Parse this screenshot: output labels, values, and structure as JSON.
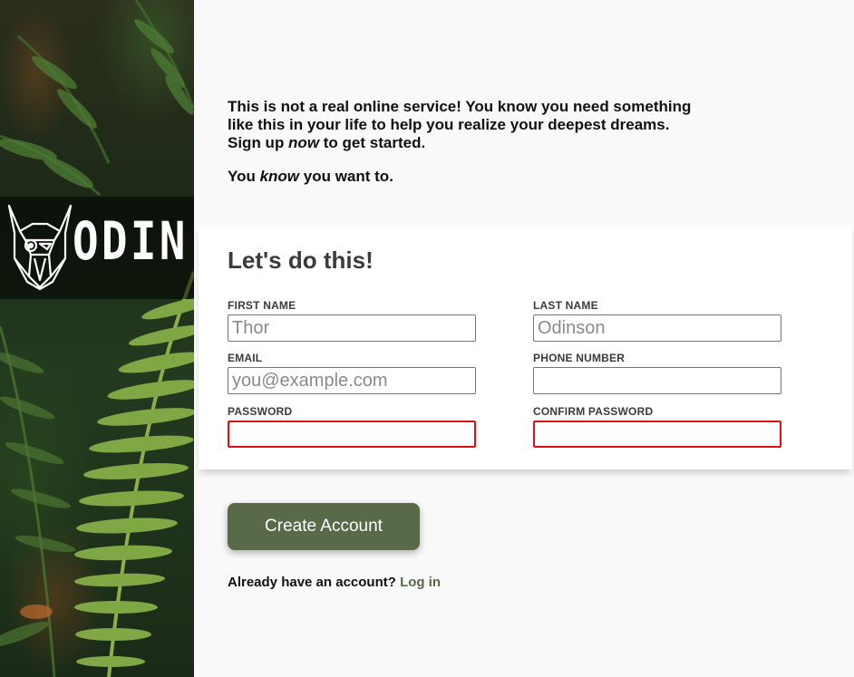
{
  "brand": {
    "name": "ODIN",
    "logo_icon": "viking-helmet-icon"
  },
  "intro": {
    "line1": "This is not a real online service! You know you need something like this in your life to help you realize your deepest dreams.",
    "signup_prefix": "Sign up ",
    "signup_em": "now",
    "signup_suffix": " to get started.",
    "know_prefix": "You ",
    "know_em": "know",
    "know_suffix": " you want to."
  },
  "form": {
    "title": "Let's do this!",
    "first_name": {
      "label": "FIRST NAME",
      "placeholder": "Thor",
      "value": ""
    },
    "last_name": {
      "label": "LAST NAME",
      "placeholder": "Odinson",
      "value": ""
    },
    "email": {
      "label": "EMAIL",
      "placeholder": "you@example.com",
      "value": ""
    },
    "phone": {
      "label": "PHONE NUMBER",
      "placeholder": "",
      "value": ""
    },
    "password": {
      "label": "PASSWORD",
      "placeholder": "",
      "value": ""
    },
    "confirm_password": {
      "label": "CONFIRM PASSWORD",
      "placeholder": "",
      "value": ""
    }
  },
  "actions": {
    "create_label": "Create Account",
    "login_prompt": "Already have an account?",
    "login_link": "Log in"
  },
  "colors": {
    "accent": "#596a48",
    "invalid_border": "#dd1111",
    "page_bg": "#f9f9f9"
  }
}
